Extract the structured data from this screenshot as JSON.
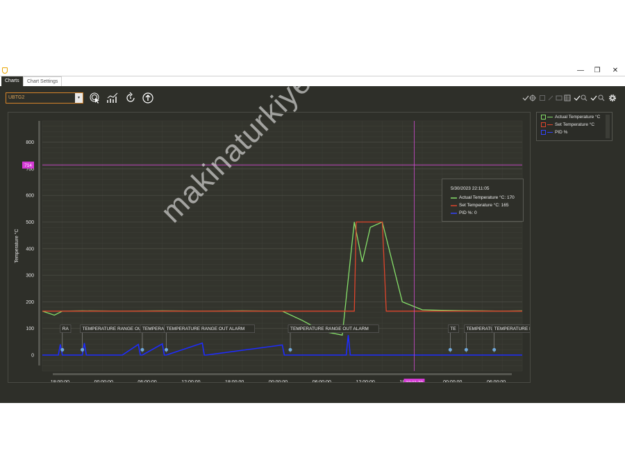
{
  "tabs": [
    {
      "label": "Charts",
      "active": true
    },
    {
      "label": "Chart Settings",
      "active": false
    }
  ],
  "window_controls": [
    "—",
    "❐",
    "✕"
  ],
  "device_select": {
    "value": "UBTG2"
  },
  "icons": [
    "touch-icon",
    "trend-icon",
    "reset-icon",
    "upload-icon",
    "settings-icon"
  ],
  "chart_data": {
    "type": "line",
    "xlabel": "",
    "ylabel": "Temperature °C",
    "ylim": [
      -60,
      880
    ],
    "y_ticks": [
      "800",
      "700",
      "600",
      "500",
      "400",
      "300",
      "200",
      "100",
      "0"
    ],
    "x_ticks": [
      "18:00:00",
      "00:00:00",
      "06:00:00",
      "12:00:00",
      "18:00:00",
      "00:00:00",
      "06:00:00",
      "12:00:00",
      "18:00:00",
      "00:00:00",
      "06:00:00"
    ],
    "cursor_x_label": "22:11:30",
    "cursor_y_label": "714",
    "series": [
      {
        "name": "Actual Temperature °C",
        "color": "#86e06a",
        "x": [
          0,
          0.3,
          0.5,
          1,
          2,
          3,
          4,
          5,
          6,
          6.5,
          7,
          7.5,
          7.8,
          8,
          8.2,
          8.5,
          9,
          9.5,
          10,
          10.5,
          11,
          11.5,
          12
        ],
        "values": [
          165,
          150,
          165,
          166,
          165,
          166,
          165,
          166,
          165,
          130,
          90,
          75,
          500,
          350,
          480,
          500,
          200,
          170,
          168,
          167,
          166,
          165,
          166
        ]
      },
      {
        "name": "Set Temperature °C",
        "color": "#e0452c",
        "x": [
          0,
          1,
          2,
          3,
          4,
          5,
          6,
          7,
          7.8,
          7.85,
          8.5,
          8.6,
          9,
          10,
          11,
          12
        ],
        "values": [
          165,
          165,
          165,
          165,
          165,
          165,
          165,
          165,
          165,
          500,
          500,
          165,
          165,
          165,
          165,
          165
        ]
      },
      {
        "name": "PID %",
        "color": "#1e2cff",
        "x": [
          0,
          0.4,
          0.45,
          0.5,
          1,
          1.05,
          1.1,
          2,
          2.4,
          2.45,
          2.5,
          3,
          3.05,
          3.1,
          4,
          4.05,
          4.1,
          6,
          6.05,
          6.1,
          7.6,
          7.65,
          7.7,
          8.5,
          12
        ],
        "values": [
          0,
          0,
          40,
          0,
          0,
          45,
          0,
          0,
          40,
          0,
          0,
          42,
          0,
          0,
          45,
          0,
          0,
          38,
          0,
          0,
          0,
          75,
          0,
          0,
          0
        ]
      }
    ],
    "cursor_time": 9.3,
    "cursor_value": 714,
    "alarms": [
      {
        "label": "RA",
        "x": 0.5
      },
      {
        "label": "TEMPERATURE RANGE OUT",
        "x": 1.0
      },
      {
        "label": "TEMPERATURE RANGE OUT ALARM",
        "x": 2.5
      },
      {
        "label": "TEMPERATURE RANGE OUT ALARM",
        "x": 3.1
      },
      {
        "label": "TEMPERATURE RANGE OUT ALARM",
        "x": 6.2
      },
      {
        "label": "TE",
        "x": 10.2
      },
      {
        "label": "TEMPERATURE RANGE OUT",
        "x": 10.6
      },
      {
        "label": "TEMPERATURE RANGE OUT",
        "x": 11.3
      }
    ],
    "tooltip": {
      "time": "5/30/2023 22:11:05",
      "lines": [
        "Actual Temperature °C: 170",
        "Set Temperature °C: 165",
        "PID %: 0"
      ]
    },
    "legend": [
      {
        "label": "Actual Temperature °C",
        "color": "#86e06a"
      },
      {
        "label": "Set Temperature °C",
        "color": "#e0452c"
      },
      {
        "label": "PID %",
        "color": "#1e2cff"
      }
    ]
  },
  "watermark": "makinaturkiye.com"
}
